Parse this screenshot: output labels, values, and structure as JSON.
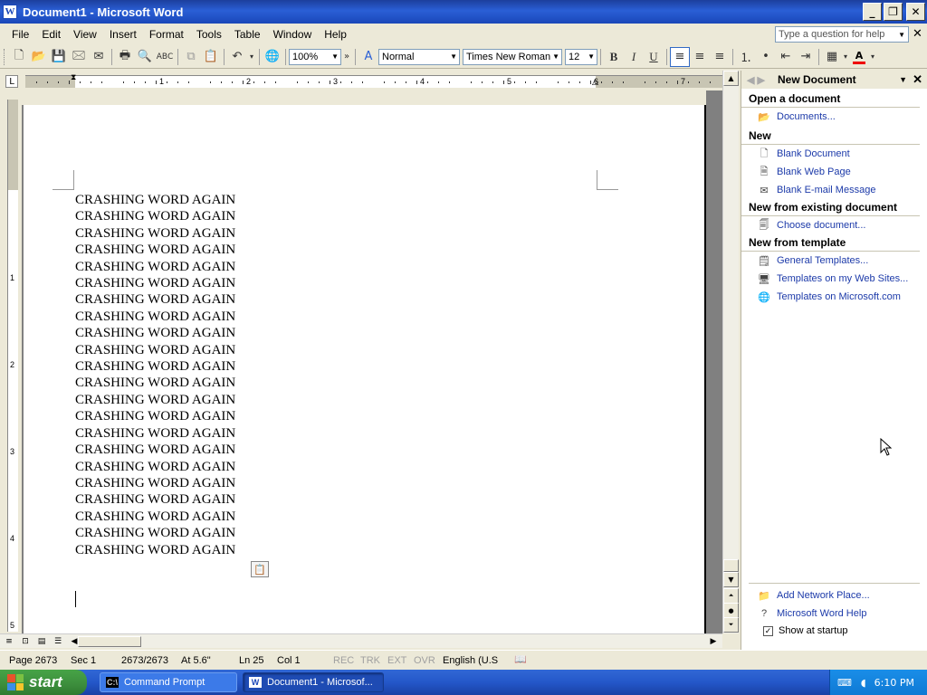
{
  "window": {
    "title": "Document1 - Microsoft Word",
    "app_letter": "W"
  },
  "menu": [
    "File",
    "Edit",
    "View",
    "Insert",
    "Format",
    "Tools",
    "Table",
    "Window",
    "Help"
  ],
  "help_box": {
    "placeholder": "Type a question for help"
  },
  "toolbar": {
    "zoom": "100%",
    "style": "Normal",
    "font": "Times New Roman",
    "size": "12",
    "bold": "B",
    "italic": "I",
    "underline": "U",
    "font_color_letter": "A"
  },
  "ruler": {
    "numbers": [
      "1",
      "2",
      "3",
      "4",
      "5",
      "6",
      "7"
    ],
    "vertical_numbers": [
      "1",
      "2",
      "3",
      "4",
      "5"
    ]
  },
  "document": {
    "lines": [
      "CRASHING WORD AGAIN",
      "CRASHING WORD AGAIN",
      "CRASHING WORD AGAIN",
      "CRASHING WORD AGAIN",
      "CRASHING WORD AGAIN",
      "CRASHING WORD AGAIN",
      "CRASHING WORD AGAIN",
      "CRASHING WORD AGAIN",
      "CRASHING WORD AGAIN",
      "CRASHING WORD AGAIN",
      "CRASHING WORD AGAIN",
      "CRASHING WORD AGAIN",
      "CRASHING WORD AGAIN",
      "CRASHING WORD AGAIN",
      "CRASHING WORD AGAIN",
      "CRASHING WORD AGAIN",
      "CRASHING WORD AGAIN",
      "CRASHING WORD AGAIN",
      "CRASHING WORD AGAIN",
      "CRASHING WORD AGAIN",
      "CRASHING WORD AGAIN",
      "CRASHING WORD AGAIN"
    ]
  },
  "status": {
    "page": "Page 2673",
    "sec": "Sec 1",
    "pages": "2673/2673",
    "at": "At 5.6\"",
    "ln": "Ln 25",
    "col": "Col 1",
    "rec": "REC",
    "trk": "TRK",
    "ext": "EXT",
    "ovr": "OVR",
    "language": "English (U.S"
  },
  "taskpane": {
    "title": "New Document",
    "sections": {
      "open": {
        "heading": "Open a document",
        "items": [
          "Documents..."
        ]
      },
      "new": {
        "heading": "New",
        "items": [
          "Blank Document",
          "Blank Web Page",
          "Blank E-mail Message"
        ]
      },
      "existing": {
        "heading": "New from existing document",
        "items": [
          "Choose document..."
        ]
      },
      "template": {
        "heading": "New from template",
        "items": [
          "General Templates...",
          "Templates on my Web Sites...",
          "Templates on Microsoft.com"
        ]
      }
    },
    "bottom": [
      "Add Network Place...",
      "Microsoft Word Help"
    ],
    "show_at_startup": "Show at startup"
  },
  "taskbar": {
    "start": "start",
    "tasks": [
      "Command Prompt",
      "Document1 - Microsof..."
    ],
    "clock": "6:10 PM"
  },
  "colors": {
    "link": "#1c3aa9",
    "taskbar": "#2457c9",
    "start": "#3c8d3c"
  }
}
